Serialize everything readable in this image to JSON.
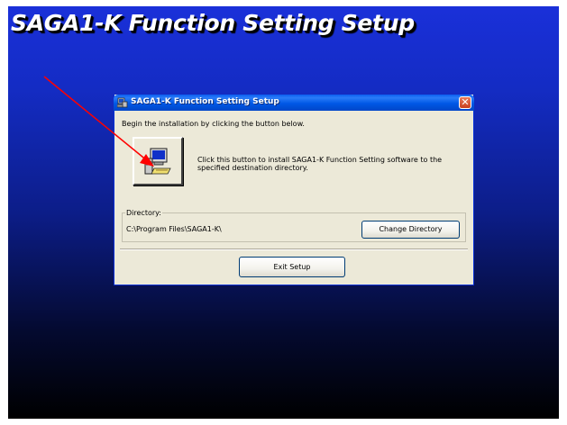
{
  "banner": {
    "title": "SAGA1-K Function Setting Setup"
  },
  "dialog": {
    "title": "SAGA1-K Function Setting Setup",
    "close_symbol": "✕",
    "intro": "Begin the installation by clicking the button below.",
    "install_description": "Click this button to install SAGA1-K Function Setting software to the specified destination directory.",
    "directory_label": "Directory:",
    "directory_path": "C:\\Program Files\\SAGA1-K\\",
    "change_directory_button": "Change Directory",
    "exit_button": "Exit Setup"
  },
  "icons": {
    "title_icon": "setup-computer-icon",
    "install_icon": "computer-install-icon",
    "close_icon": "close-icon",
    "annotation": "red-arrow-annotation"
  },
  "colors": {
    "desktop_top": "#1a30d9",
    "desktop_bottom": "#000000",
    "dialog_face": "#ece9d8",
    "titlebar": "#0058e6",
    "close_button": "#c8401f",
    "annotation_arrow": "#ff0000"
  }
}
